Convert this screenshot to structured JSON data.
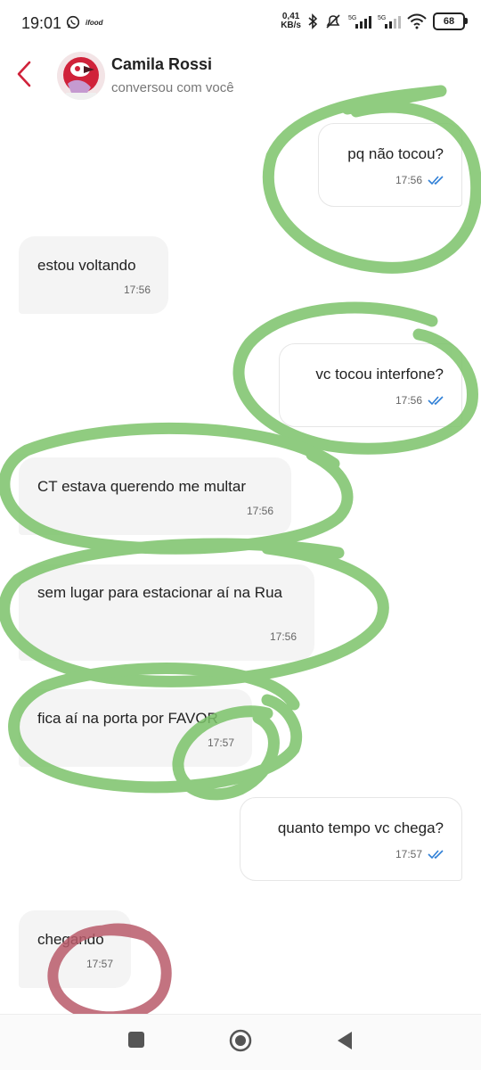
{
  "status_bar": {
    "time": "19:01",
    "speed_value": "0,41",
    "speed_unit": "KB/s",
    "battery": "68",
    "icons": [
      "whatsapp-icon",
      "ifood-icon",
      "bluetooth-icon",
      "mute-icon",
      "signal-5g-icon",
      "signal-5g-icon",
      "wifi-icon",
      "battery-icon"
    ]
  },
  "header": {
    "contact_name": "Camila Rossi",
    "subtitle": "conversou com você",
    "back_icon": "chevron-left-icon",
    "accent": "#d0223a"
  },
  "messages": [
    {
      "dir": "out",
      "text": "pq não tocou?",
      "time": "17:56"
    },
    {
      "dir": "in",
      "text": "estou voltando",
      "time": "17:56"
    },
    {
      "dir": "out",
      "text": "vc tocou interfone?",
      "time": "17:56"
    },
    {
      "dir": "in",
      "text": "CT estava querendo me multar",
      "time": "17:56"
    },
    {
      "dir": "in",
      "text": "sem lugar para estacionar aí na Rua",
      "time": "17:56"
    },
    {
      "dir": "in",
      "text": "fica aí na porta por FAVOR",
      "time": "17:57"
    },
    {
      "dir": "out",
      "text": "quanto tempo vc chega?",
      "time": "17:57"
    },
    {
      "dir": "in",
      "text": "chegando",
      "time": "17:57"
    }
  ],
  "colors": {
    "read_ticks": "#2f7fd6",
    "green_scribble": "#7cc36a",
    "red_scribble": "#b85a6a"
  },
  "nav": {
    "icons": [
      "recents-square-icon",
      "home-circle-icon",
      "back-triangle-icon"
    ]
  }
}
